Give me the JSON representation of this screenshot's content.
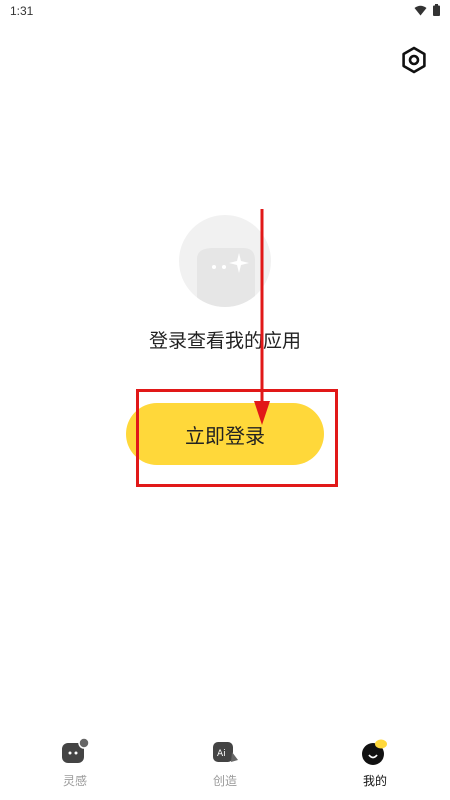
{
  "status_bar": {
    "time": "1:31"
  },
  "main": {
    "prompt": "登录查看我的应用",
    "login_button": "立即登录"
  },
  "tabbar": {
    "items": [
      {
        "label": "灵感",
        "icon": "inspiration-icon",
        "active": false
      },
      {
        "label": "创造",
        "icon": "ai-create-icon",
        "active": false
      },
      {
        "label": "我的",
        "icon": "profile-icon",
        "active": true
      }
    ]
  },
  "colors": {
    "accent": "#ffd83a",
    "highlight": "#e11818"
  }
}
